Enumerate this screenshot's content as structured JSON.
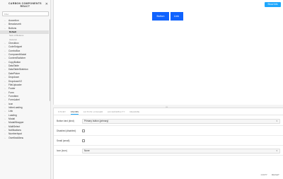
{
  "sidebar": {
    "title_line1": "CARBON COMPONENTS",
    "title_line2": "REACT",
    "filter_placeholder": "Filter",
    "items_before": [
      "Accordion",
      "Breadcrumb",
      "Buttons"
    ],
    "subitems": [
      {
        "label": "Default",
        "active": true
      },
      {
        "label": "Sets of Buttons",
        "active": false
      },
      {
        "label": "skeleton",
        "active": false
      }
    ],
    "items_after": [
      "Checkbox",
      "CodeSnippet",
      "ComboBox",
      "ComposedModal",
      "ContentSwitcher",
      "CopyButton",
      "DataTable",
      "DataTableSkeleton",
      "DatePicker",
      "Dropdown",
      "DropdownV2",
      "FileUploader",
      "Footer",
      "Form",
      "FormItem",
      "FormLabel",
      "Icon",
      "InlineLoading",
      "Link",
      "Loading",
      "Modal",
      "ModalWrapper",
      "MultiSelect",
      "Notifications",
      "NumberInput",
      "OverflowMenu"
    ]
  },
  "preview": {
    "show_info_label": "Show Info",
    "button_label": "Button",
    "link_label": "Link"
  },
  "addons": {
    "tabs": [
      "STORY",
      "KNOBS",
      "ACTION LOGGER",
      "ACCESSIBILITY",
      "README"
    ],
    "active_tab": 1,
    "controls": {
      "kind_label": "Button kind (kind)",
      "kind_value": "Primary button (primary)",
      "disabled_label": "Disabled (disabled)",
      "small_label": "Small (small)",
      "icon_label": "Icon (icon)",
      "icon_value": "None"
    },
    "copy_label": "COPY",
    "reset_label": "RESET"
  }
}
